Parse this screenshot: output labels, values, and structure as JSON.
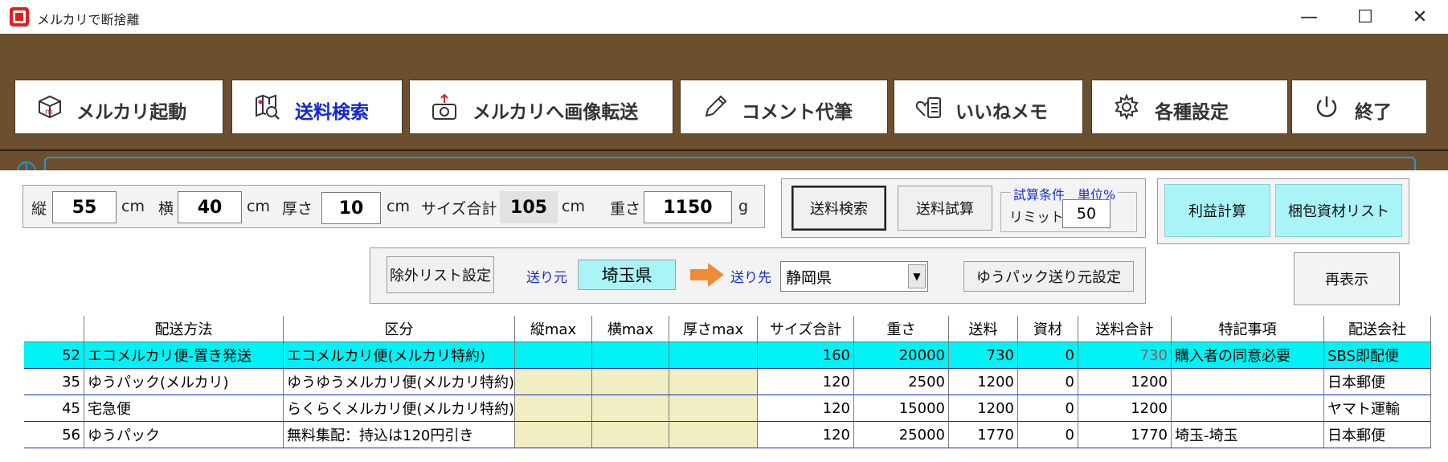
{
  "window": {
    "title": "メルカリで断捨離",
    "minimize": "—",
    "maximize": "☐",
    "close": "✕"
  },
  "toolbar": {
    "buttons": [
      {
        "label": "メルカリ起動",
        "icon": "mercari-box-icon",
        "active": false
      },
      {
        "label": "送料検索",
        "icon": "map-search-icon",
        "active": true
      },
      {
        "label": "メルカリへ画像転送",
        "icon": "camera-upload-icon",
        "active": false
      },
      {
        "label": "コメント代筆",
        "icon": "pencil-icon",
        "active": false
      },
      {
        "label": "いいねメモ",
        "icon": "heart-memo-icon",
        "active": false
      },
      {
        "label": "各種設定",
        "icon": "gear-icon",
        "active": false
      },
      {
        "label": "終了",
        "icon": "power-icon",
        "active": false
      }
    ],
    "status_text": ""
  },
  "dimensions": {
    "height_label": "縦",
    "height_value": "55",
    "width_label": "横",
    "width_value": "40",
    "thickness_label": "厚さ",
    "thickness_value": "10",
    "unit_cm": "cm",
    "size_total_label": "サイズ合計",
    "size_total_value": "105",
    "weight_label": "重さ",
    "weight_value": "1150",
    "unit_g": "g"
  },
  "search": {
    "search_button": "送料検索",
    "estimate_button": "送料試算",
    "condition_legend": "試算条件　単位%",
    "limit_label": "リミット",
    "limit_value": "50"
  },
  "tools": {
    "profit_button": "利益計算",
    "packing_button": "梱包資材リスト",
    "refresh_button": "再表示"
  },
  "route": {
    "exclude_button": "除外リスト設定",
    "from_label": "送り元",
    "from_value": "埼玉県",
    "to_label": "送り先",
    "to_value": "静岡県",
    "yupack_button": "ゆうパック送り元設定"
  },
  "table": {
    "headers": [
      "",
      "配送方法",
      "区分",
      "縦max",
      "横max",
      "厚さmax",
      "サイズ合計",
      "重さ",
      "送料",
      "資材",
      "送料合計",
      "特記事項",
      "配送会社"
    ],
    "rows": [
      {
        "no": "52",
        "method": "エコメルカリ便-置き発送",
        "category": "エコメルカリ便(メルカリ特約)",
        "hmax": "",
        "wmax": "",
        "tmax": "",
        "size": "160",
        "weight": "20000",
        "fee": "730",
        "material": "0",
        "total": "730",
        "note": "購入者の同意必要",
        "carrier": "SBS即配便",
        "highlight": true
      },
      {
        "no": "35",
        "method": "ゆうパック(メルカリ)",
        "category": "ゆうゆうメルカリ便(メルカリ特約)",
        "hmax": "",
        "wmax": "",
        "tmax": "",
        "size": "120",
        "weight": "2500",
        "fee": "1200",
        "material": "0",
        "total": "1200",
        "note": "",
        "carrier": "日本郵便",
        "highlight": false
      },
      {
        "no": "45",
        "method": "宅急便",
        "category": "らくらくメルカリ便(メルカリ特約)",
        "hmax": "",
        "wmax": "",
        "tmax": "",
        "size": "120",
        "weight": "15000",
        "fee": "1200",
        "material": "0",
        "total": "1200",
        "note": "",
        "carrier": "ヤマト運輸",
        "highlight": false
      },
      {
        "no": "56",
        "method": "ゆうパック",
        "category": "無料集配：持込は120円引き",
        "hmax": "",
        "wmax": "",
        "tmax": "",
        "size": "120",
        "weight": "25000",
        "fee": "1770",
        "material": "0",
        "total": "1770",
        "note": "埼玉-埼玉",
        "carrier": "日本郵便",
        "highlight": false
      }
    ]
  },
  "colors": {
    "toolbar_bg": "#6b4f2f",
    "active_text": "#1426d6",
    "highlight_row": "#00f2f4",
    "max_cell": "#f1eec4",
    "border_blue": "#1a2acc"
  }
}
